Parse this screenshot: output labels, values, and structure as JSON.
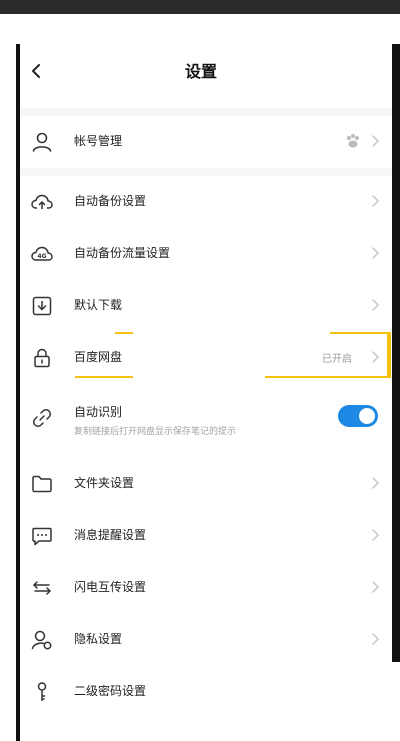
{
  "header": {
    "title": "设置"
  },
  "rows": {
    "account": {
      "label": "帐号管理",
      "icon": "user-icon",
      "badge_icon": "baidu-paw-icon"
    },
    "auto_backup": {
      "label": "自动备份设置",
      "icon": "cloud-upload-icon"
    },
    "backup_traffic": {
      "label": "自动备份流量设置",
      "icon": "cloud-4g-icon"
    },
    "default_download": {
      "label": "默认下载",
      "icon": "download-icon"
    },
    "baidu_pan": {
      "label": "百度网盘",
      "icon": "lock-icon",
      "status": "已开启"
    },
    "auto_identify": {
      "label": "自动识别",
      "icon": "link-icon",
      "subtitle": "复制链接后打开网盘显示保存笔记的提示",
      "enabled": true
    },
    "folder_settings": {
      "label": "文件夹设置",
      "icon": "folder-icon"
    },
    "notification": {
      "label": "消息提醒设置",
      "icon": "chat-icon"
    },
    "flash_transfer": {
      "label": "闪电互传设置",
      "icon": "transfer-icon"
    },
    "privacy": {
      "label": "隐私设置",
      "icon": "privacy-user-icon"
    },
    "secondary_password": {
      "label": "二级密码设置",
      "icon": "key-icon"
    }
  },
  "colors": {
    "accent": "#1e88e5",
    "highlight": "#f4c20d"
  }
}
